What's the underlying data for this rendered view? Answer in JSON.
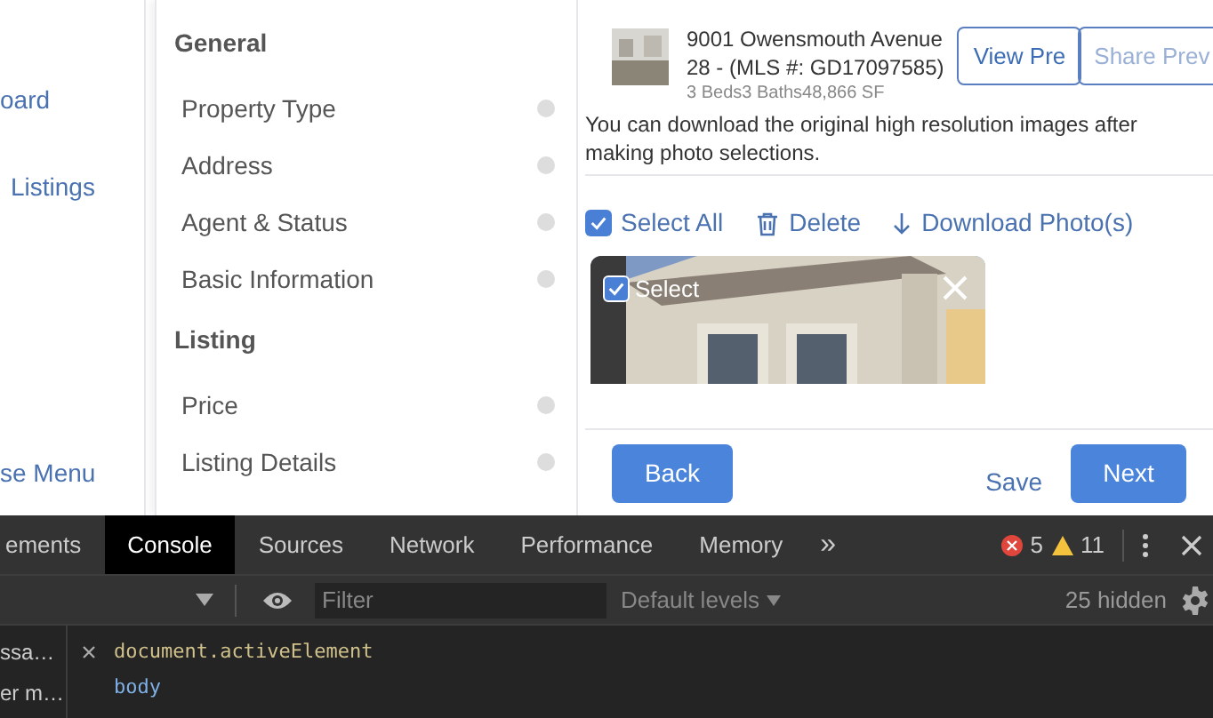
{
  "nav": {
    "items": [
      {
        "label": "oard"
      },
      {
        "label": "Listings"
      },
      {
        "label": "se Menu"
      }
    ]
  },
  "sections": [
    {
      "title": "General",
      "items": [
        {
          "label": "Property Type",
          "complete": false
        },
        {
          "label": "Address",
          "complete": false
        },
        {
          "label": "Agent & Status",
          "complete": false
        },
        {
          "label": "Basic Information",
          "complete": false
        }
      ]
    },
    {
      "title": "Listing",
      "items": [
        {
          "label": "Price",
          "complete": false
        },
        {
          "label": "Listing Details",
          "complete": false
        }
      ]
    }
  ],
  "listing": {
    "address": "9001 Owensmouth Avenue 28 - (MLS #: GD17097585)",
    "stats": "3 Beds3 Baths48,866 SF",
    "buttons": [
      "View Pre",
      "Share Prev"
    ]
  },
  "description": "You can download the original high resolution images after making photo selections.",
  "toolbar": {
    "select_all": {
      "label": "Select All",
      "checked": true
    },
    "delete": "Delete",
    "download": "Download Photo(s)"
  },
  "photos": [
    {
      "kind": "picture",
      "select_label": "Select",
      "checked": true
    }
  ],
  "footer": {
    "back": "Back",
    "save": "Save",
    "next": "Next"
  },
  "devtools": {
    "tabs": [
      {
        "label": "ements",
        "selected": false
      },
      {
        "label": "Console",
        "selected": true
      },
      {
        "label": "Sources",
        "selected": false
      },
      {
        "label": "Network",
        "selected": false
      },
      {
        "label": "Performance",
        "selected": false
      },
      {
        "label": "Memory",
        "selected": false
      }
    ],
    "more": "»",
    "errors": "5",
    "warnings": "11",
    "filter_placeholder": "Filter",
    "levels": "Default levels",
    "hidden": "25 hidden",
    "sidebar": [
      "ssa…",
      "er m…"
    ],
    "expression": "document.activeElement",
    "result": "body"
  }
}
